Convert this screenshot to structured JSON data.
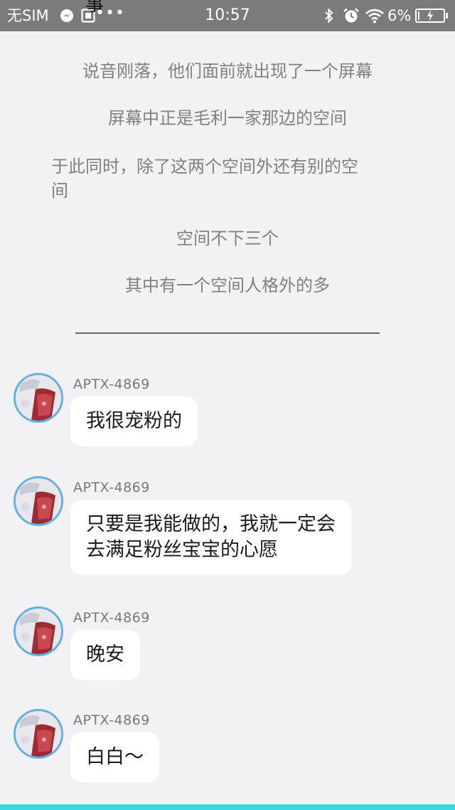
{
  "status_bar": {
    "carrier": "无SIM",
    "notification_text": "事",
    "overflow": "•••",
    "time": "10:57",
    "battery_percent": "6%",
    "icons": [
      "messenger-icon",
      "image-icon",
      "bluetooth-icon",
      "alarm-icon",
      "wifi-icon",
      "battery-charging-icon"
    ],
    "battery_level": 0.06
  },
  "story": {
    "lines": [
      "说音刚落，他们面前就出现了一个屏幕",
      "屏幕中正是毛利一家那边的空间",
      "于此同时，除了这两个空间外还有别的空",
      "间",
      "空间不下三个",
      "其中有一个空间人格外的多"
    ]
  },
  "chat": {
    "messages": [
      {
        "sender": "APTX-4869",
        "lines": [
          "我很宠粉的"
        ]
      },
      {
        "sender": "APTX-4869",
        "lines": [
          "只要是我能做的，我就一定会",
          "去满足粉丝宝宝的心愿"
        ]
      },
      {
        "sender": "APTX-4869",
        "lines": [
          "晚安"
        ]
      },
      {
        "sender": "APTX-4869",
        "lines": [
          "白白～"
        ]
      }
    ]
  },
  "colors": {
    "status_bar": "#7b7b7d",
    "background": "#f2f2f4",
    "avatar_ring": "#63b0e4",
    "bottom_accent": "#3fd6dd"
  }
}
